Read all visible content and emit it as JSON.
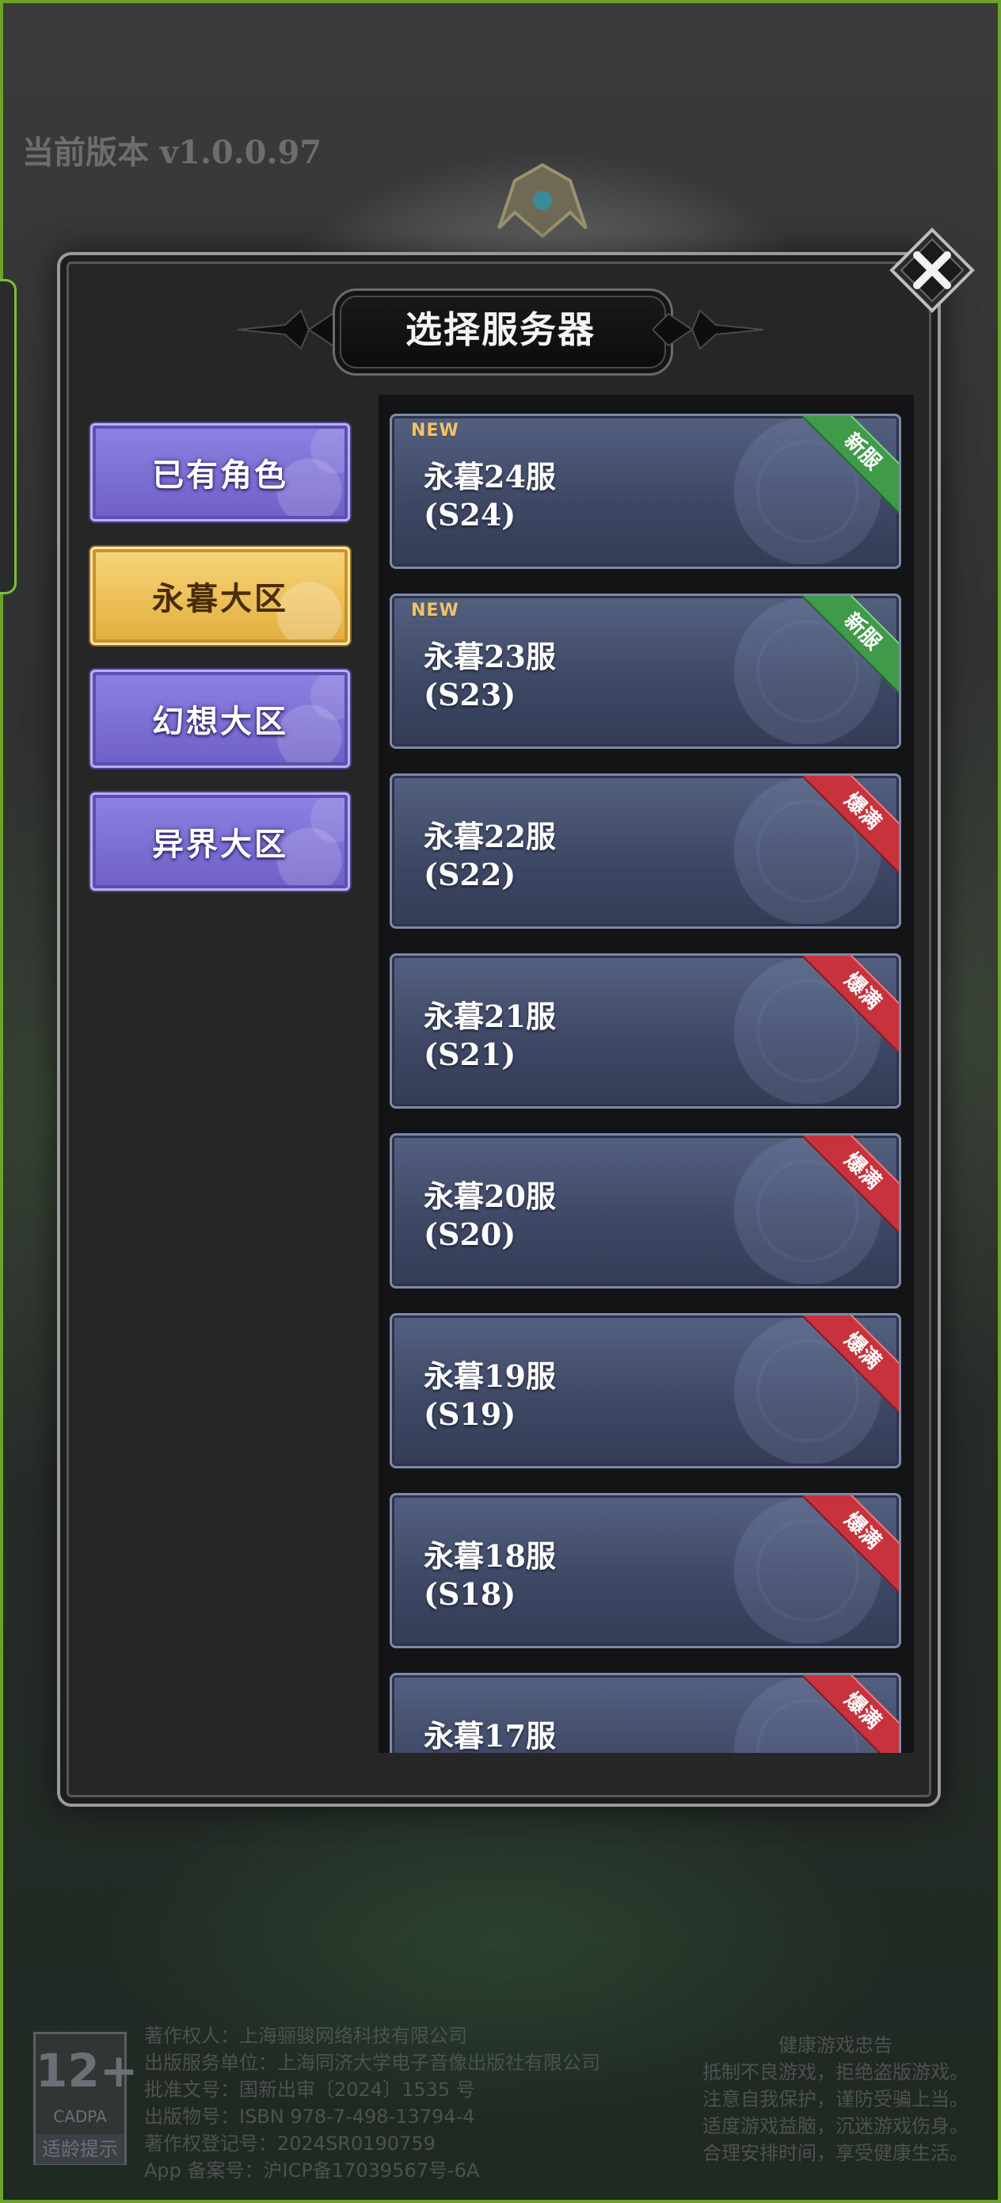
{
  "version_label": "当前版本 v1.0.0.97",
  "dialog": {
    "title": "选择服务器",
    "close_icon": "close-icon"
  },
  "regions": [
    {
      "label": "已有角色",
      "selected": false
    },
    {
      "label": "永暮大区",
      "selected": true
    },
    {
      "label": "幻想大区",
      "selected": false
    },
    {
      "label": "异界大区",
      "selected": false
    }
  ],
  "servers": [
    {
      "name": "永暮24服",
      "code": "(S24)",
      "new_tag": "NEW",
      "status": "新服",
      "status_color": "#3f9a4a"
    },
    {
      "name": "永暮23服",
      "code": "(S23)",
      "new_tag": "NEW",
      "status": "新服",
      "status_color": "#3f9a4a"
    },
    {
      "name": "永暮22服",
      "code": "(S22)",
      "new_tag": "",
      "status": "爆满",
      "status_color": "#c8323c"
    },
    {
      "name": "永暮21服",
      "code": "(S21)",
      "new_tag": "",
      "status": "爆满",
      "status_color": "#c8323c"
    },
    {
      "name": "永暮20服",
      "code": "(S20)",
      "new_tag": "",
      "status": "爆满",
      "status_color": "#c8323c"
    },
    {
      "name": "永暮19服",
      "code": "(S19)",
      "new_tag": "",
      "status": "爆满",
      "status_color": "#c8323c"
    },
    {
      "name": "永暮18服",
      "code": "(S18)",
      "new_tag": "",
      "status": "爆满",
      "status_color": "#c8323c"
    },
    {
      "name": "永暮17服",
      "code": "",
      "new_tag": "",
      "status": "爆满",
      "status_color": "#c8323c"
    }
  ],
  "footer": {
    "age_rating": "12+",
    "age_org": "CADPA",
    "age_hint": "适龄提示",
    "copyright_lines": [
      "著作权人：上海骊骏网络科技有限公司",
      "出版服务单位：上海同济大学电子音像出版社有限公司",
      "批准文号：国新出审〔2024〕1535 号",
      "出版物号：ISBN 978-7-498-13794-4",
      "著作权登记号：2024SR0190759",
      "App 备案号：沪ICP备17039567号-6A"
    ],
    "health_title": "健康游戏忠告",
    "health_lines": [
      "抵制不良游戏，拒绝盗版游戏。",
      "注意自我保护，谨防受骗上当。",
      "适度游戏益脑，沉迷游戏伤身。",
      "合理安排时间，享受健康生活。"
    ]
  }
}
